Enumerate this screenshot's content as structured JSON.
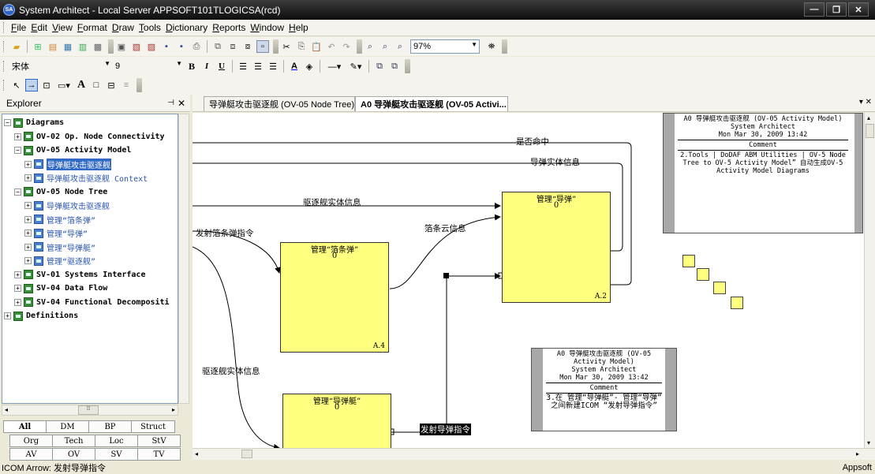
{
  "window": {
    "title": "System Architect - Local Server APPSOFT101TLOGICSA(rcd)",
    "icon_text": "SA",
    "min": "—",
    "max": "❐",
    "close": "✕"
  },
  "menu": [
    "File",
    "Edit",
    "View",
    "Format",
    "Draw",
    "Tools",
    "Dictionary",
    "Reports",
    "Window",
    "Help"
  ],
  "toolbar": {
    "zoom": "97%",
    "font_name": "宋体",
    "font_size": "9"
  },
  "explorer": {
    "title": "Explorer",
    "tree": [
      {
        "label": "Diagrams",
        "depth": 0,
        "exp": "−",
        "bold": true
      },
      {
        "label": "OV-02 Op. Node Connectivity",
        "depth": 1,
        "exp": "+",
        "bold": true
      },
      {
        "label": "OV-05 Activity Model",
        "depth": 1,
        "exp": "−",
        "bold": true
      },
      {
        "label": "导弹艇攻击驱逐舰",
        "depth": 2,
        "exp": "+",
        "sel": true
      },
      {
        "label": "导弹艇攻击驱逐舰 Context",
        "depth": 2,
        "exp": "+",
        "ctx": true
      },
      {
        "label": "OV-05 Node Tree",
        "depth": 1,
        "exp": "−",
        "bold": true
      },
      {
        "label": "导弹艇攻击驱逐舰",
        "depth": 2,
        "exp": "+",
        "ctx": true
      },
      {
        "label": "管理“箔条弹”",
        "depth": 2,
        "exp": "+",
        "ctx": true
      },
      {
        "label": "管理“导弹”",
        "depth": 2,
        "exp": "+",
        "ctx": true
      },
      {
        "label": "管理“导弹艇”",
        "depth": 2,
        "exp": "+",
        "ctx": true
      },
      {
        "label": "管理“驱逐舰”",
        "depth": 2,
        "exp": "+",
        "ctx": true
      },
      {
        "label": "SV-01 Systems Interface",
        "depth": 1,
        "exp": "+",
        "bold": true
      },
      {
        "label": "SV-04 Data Flow",
        "depth": 1,
        "exp": "+",
        "bold": true
      },
      {
        "label": "SV-04 Functional Decompositi",
        "depth": 1,
        "exp": "+",
        "bold": true
      },
      {
        "label": "Definitions",
        "depth": 0,
        "exp": "+",
        "bold": true
      }
    ],
    "tabs_row1": [
      "All",
      "DM",
      "BP",
      "Struct"
    ],
    "tabs_row2": [
      "Org",
      "Tech",
      "Loc",
      "StV"
    ],
    "tabs_row3": [
      "AV",
      "OV",
      "SV",
      "TV"
    ]
  },
  "doc_tabs": [
    "导弹艇攻击驱逐舰 (OV-05 Node Tree)",
    "A0 导弹艇攻击驱逐舰 (OV-05 Activi..."
  ],
  "diagram": {
    "boxes": [
      {
        "name": "管理“箔条弹”",
        "cost": "0",
        "num": "A.4"
      },
      {
        "name": "管理“导弹”",
        "cost": "0",
        "num": "A.2"
      },
      {
        "name": "管理“导弹艇”",
        "cost": "0",
        "num": ""
      }
    ],
    "labels": {
      "hit": "是否命中",
      "missile_info": "导弹实体信息",
      "destroyer_info": "驱逐舰实体信息",
      "launch_chaff": "发射箔条弹指令",
      "chaff_cloud": "箔条云信息",
      "destroyer_info2": "驱逐舰实体信息",
      "launch_missile": "发射导弹指令"
    },
    "note1": {
      "header": "A0 导弹艇攻击驱逐舰 (OV-05 Activity Model)",
      "app": "System Architect",
      "date": "Mon Mar 30, 2009  13:42",
      "comment_label": "Comment",
      "comment": "2.Tools | DoDAF ABM Utilities | OV-5 Node Tree to OV-5 Activity Model” 自动生成OV-5 Activity Model Diagrams"
    },
    "note2": {
      "header": "A0 导弹艇攻击驱逐舰 (OV-05 Activity Model)",
      "app": "System Architect",
      "date": "Mon Mar 30, 2009  13:42",
      "comment_label": "Comment",
      "comment": "3.在 管理“导弹艇”- 管理“导弹” 之间新建ICOM “发射导弹指令”"
    }
  },
  "status": {
    "left": "ICOM Arrow: 发射导弹指令",
    "right": "Appsoft"
  }
}
